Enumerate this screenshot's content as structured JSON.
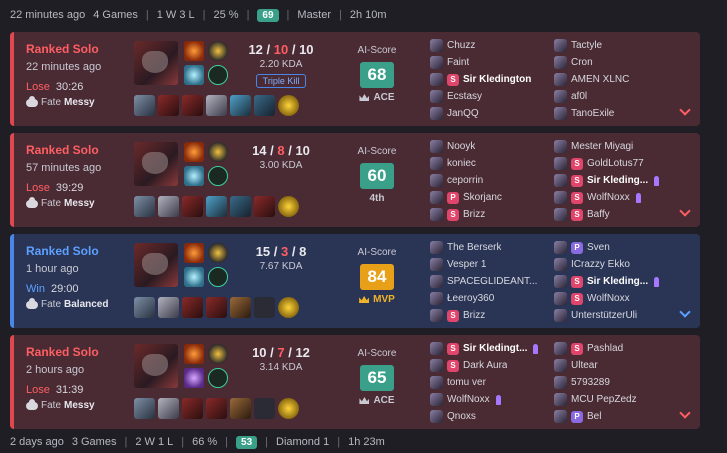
{
  "summary_top": {
    "ago": "22 minutes ago",
    "games": "4 Games",
    "wl": "1 W 3 L",
    "wr": "25 %",
    "badge": "69",
    "rank": "Master",
    "dur": "2h 10m"
  },
  "summary_bottom": {
    "ago": "2 days ago",
    "games": "3 Games",
    "wl": "2 W 1 L",
    "wr": "66 %",
    "badge": "53",
    "rank": "Diamond 1",
    "dur": "1h 23m"
  },
  "matches": [
    {
      "queue": "Ranked Solo",
      "ago": "22 minutes ago",
      "result": "Lose",
      "time": "30:26",
      "fate_label": "Fate",
      "fate": "Messy",
      "k": "12",
      "d": "10",
      "a": "10",
      "kda": "2.20 KDA",
      "tag": "Triple Kill",
      "ai_label": "AI-Score",
      "score": "68",
      "rank": "ACE",
      "team1": [
        "Chuzz",
        "Faint",
        "Sir Kledington",
        "Ecstasy",
        "JanQQ"
      ],
      "team2": [
        "Tactyle",
        "Cron",
        "AMEN XLNC",
        "af0l",
        "TanoExile"
      ]
    },
    {
      "queue": "Ranked Solo",
      "ago": "57 minutes ago",
      "result": "Lose",
      "time": "39:29",
      "fate_label": "Fate",
      "fate": "Messy",
      "k": "14",
      "d": "8",
      "a": "10",
      "kda": "3.00 KDA",
      "tag": "",
      "ai_label": "AI-Score",
      "score": "60",
      "rank": "4th",
      "team1": [
        "Nooyk",
        "koniec",
        "ceporrin",
        "Škorjanc",
        "Brizz"
      ],
      "team2": [
        "Mester Miyagi",
        "GoldLotus77",
        "Sir Kleding...",
        "WolfNoxx",
        "Baffy"
      ]
    },
    {
      "queue": "Ranked Solo",
      "ago": "1 hour ago",
      "result": "Win",
      "time": "29:00",
      "fate_label": "Fate",
      "fate": "Balanced",
      "k": "15",
      "d": "3",
      "a": "8",
      "kda": "7.67 KDA",
      "tag": "",
      "ai_label": "AI-Score",
      "score": "84",
      "rank": "MVP",
      "team1": [
        "The Berserk",
        "Vesper 1",
        "SPACEGLIDEANT...",
        "Łeeroy360",
        "Brizz"
      ],
      "team2": [
        "Sven",
        "ICrazzy Ekko",
        "Sir Kleding...",
        "WolfNoxx",
        "UnterstützerUli"
      ]
    },
    {
      "queue": "Ranked Solo",
      "ago": "2 hours ago",
      "result": "Lose",
      "time": "31:39",
      "fate_label": "Fate",
      "fate": "Messy",
      "k": "10",
      "d": "7",
      "a": "12",
      "kda": "3.14 KDA",
      "tag": "",
      "ai_label": "AI-Score",
      "score": "65",
      "rank": "ACE",
      "team1": [
        "Sir Kledingt...",
        "Dark Aura",
        "tomu ver",
        "WolfNoxx",
        "Qnoxs"
      ],
      "team2": [
        "Pashlad",
        "Ultear",
        "5793289",
        "MCU PepZedz",
        "Bel"
      ]
    }
  ]
}
